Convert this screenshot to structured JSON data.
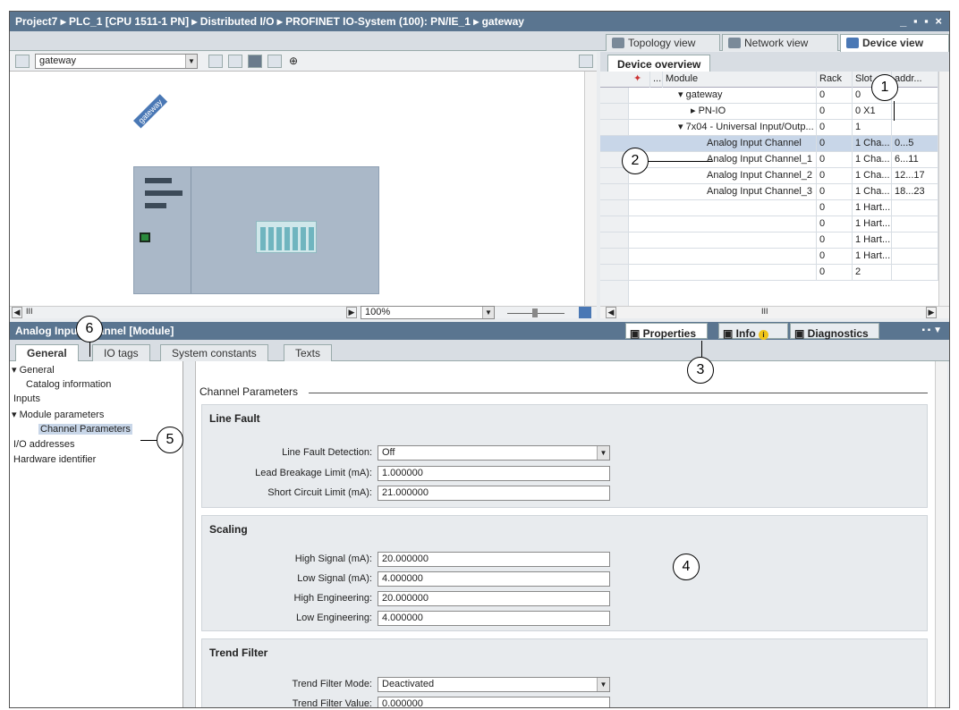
{
  "window": {
    "breadcrumb": "Project7 ▸ PLC_1 [CPU 1511-1 PN] ▸ Distributed I/O ▸ PROFINET IO-System (100): PN/IE_1 ▸ gateway",
    "controls": "_ ▪ ▪ ×"
  },
  "view_tabs": [
    {
      "label": "Topology view"
    },
    {
      "label": "Network view"
    },
    {
      "label": "Device view"
    }
  ],
  "device_canvas": {
    "device_select": "gateway",
    "device_label": "gateway",
    "zoom": "100%",
    "scroll_glyph": "III"
  },
  "device_overview": {
    "tab": "Device overview",
    "columns": [
      "...",
      "Module",
      "Rack",
      "Slot",
      "addr..."
    ],
    "rows": [
      {
        "module": "▾  gateway",
        "rack": "0",
        "slot": "0",
        "addr": ""
      },
      {
        "module": "▸  PN-IO",
        "rack": "0",
        "slot": "0 X1",
        "addr": ""
      },
      {
        "module": "▾  7x04 - Universal Input/Outp...",
        "rack": "0",
        "slot": "1",
        "addr": ""
      },
      {
        "module": "Analog Input Channel",
        "rack": "0",
        "slot": "1 Cha...",
        "addr": "0...5"
      },
      {
        "module": "Analog Input Channel_1",
        "rack": "0",
        "slot": "1 Cha...",
        "addr": "6...11"
      },
      {
        "module": "Analog Input Channel_2",
        "rack": "0",
        "slot": "1 Cha...",
        "addr": "12...17"
      },
      {
        "module": "Analog Input Channel_3",
        "rack": "0",
        "slot": "1 Cha...",
        "addr": "18...23"
      },
      {
        "module": "",
        "rack": "0",
        "slot": "1 Hart...",
        "addr": ""
      },
      {
        "module": "",
        "rack": "0",
        "slot": "1 Hart...",
        "addr": ""
      },
      {
        "module": "",
        "rack": "0",
        "slot": "1 Hart...",
        "addr": ""
      },
      {
        "module": "",
        "rack": "0",
        "slot": "1 Hart...",
        "addr": ""
      },
      {
        "module": "",
        "rack": "0",
        "slot": "2",
        "addr": ""
      }
    ],
    "scroll_glyph": "III"
  },
  "properties": {
    "title": "Analog Input Channel [Module]",
    "tabs": [
      {
        "label": "Properties"
      },
      {
        "label": "Info"
      },
      {
        "label": "Diagnostics"
      }
    ],
    "subtabs": [
      {
        "label": "General"
      },
      {
        "label": "IO tags"
      },
      {
        "label": "System constants"
      },
      {
        "label": "Texts"
      }
    ],
    "nav": [
      {
        "label": "▾ General"
      },
      {
        "label": "Catalog information"
      },
      {
        "label": "Inputs"
      },
      {
        "label": "▾ Module parameters"
      },
      {
        "label": "Channel Parameters"
      },
      {
        "label": "I/O addresses"
      },
      {
        "label": "Hardware identifier"
      }
    ],
    "section_title": "Channel Parameters",
    "groups": {
      "line_fault": {
        "title": "Line Fault",
        "fields": [
          {
            "label": "Line Fault Detection:",
            "value": "Off"
          },
          {
            "label": "Lead Breakage Limit (mA):",
            "value": "1.000000"
          },
          {
            "label": "Short Circuit Limit (mA):",
            "value": "21.000000"
          }
        ]
      },
      "scaling": {
        "title": "Scaling",
        "fields": [
          {
            "label": "High Signal (mA):",
            "value": "20.000000"
          },
          {
            "label": "Low Signal (mA):",
            "value": "4.000000"
          },
          {
            "label": "High Engineering:",
            "value": "20.000000"
          },
          {
            "label": "Low Engineering:",
            "value": "4.000000"
          }
        ]
      },
      "trend_filter": {
        "title": "Trend Filter",
        "fields": [
          {
            "label": "Trend Filter Mode:",
            "value": "Deactivated"
          },
          {
            "label": "Trend Filter Value:",
            "value": "0.000000"
          }
        ]
      }
    }
  },
  "callouts": [
    "1",
    "2",
    "3",
    "4",
    "5",
    "6"
  ]
}
